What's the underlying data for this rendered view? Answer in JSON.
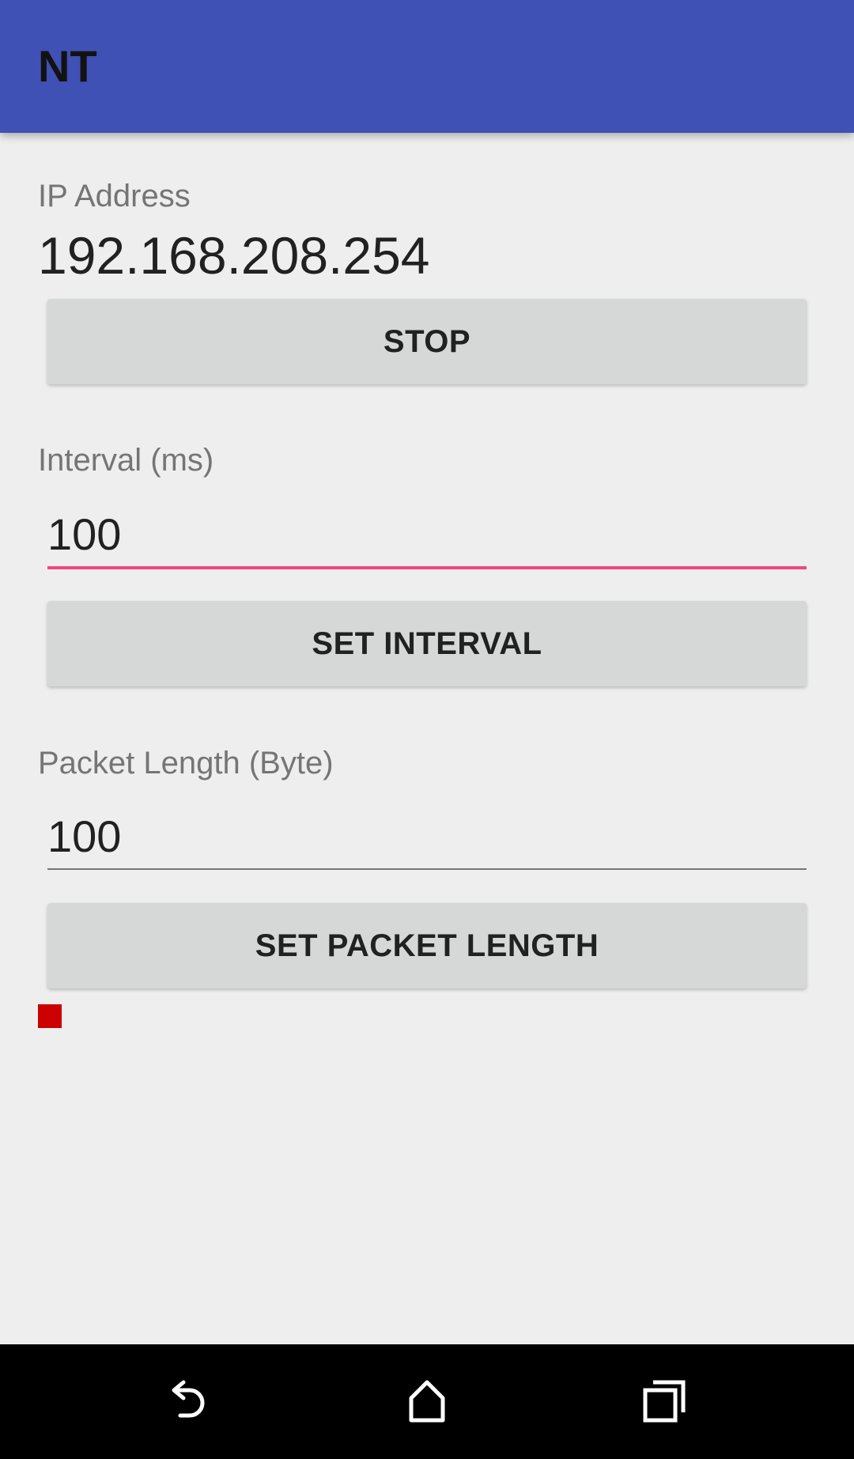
{
  "app_bar": {
    "title": "NT",
    "color": "#3f51b5"
  },
  "ip_section": {
    "label": "IP Address",
    "value": "192.168.208.254",
    "stop_label": "STOP"
  },
  "interval_section": {
    "label": "Interval (ms)",
    "value": "100",
    "button_label": "SET INTERVAL",
    "accent": "#f0467e"
  },
  "packet_section": {
    "label": "Packet Length (Byte)",
    "value": "100",
    "button_label": "SET PACKET LENGTH"
  },
  "status": {
    "color": "#cc0000",
    "icon": "status-square"
  },
  "nav": {
    "back_icon": "back-icon",
    "home_icon": "home-icon",
    "recents_icon": "recents-icon"
  }
}
